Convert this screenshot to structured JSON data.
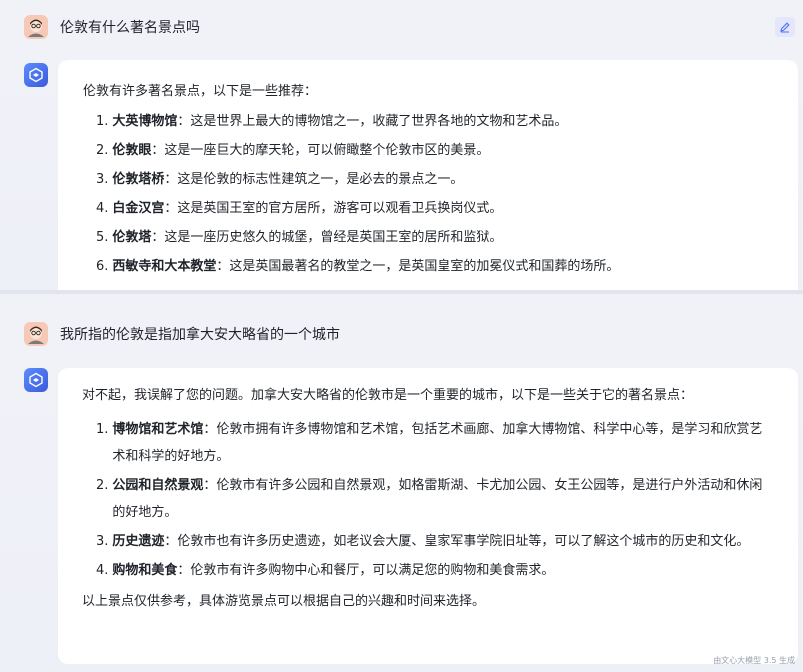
{
  "conversation": [
    {
      "user": {
        "text": "伦敦有什么著名景点吗"
      },
      "bot": {
        "intro": "伦敦有许多著名景点，以下是一些推荐：",
        "items": [
          {
            "num": "1.",
            "title": "大英博物馆",
            "desc": "：这是世界上最大的博物馆之一，收藏了世界各地的文物和艺术品。"
          },
          {
            "num": "2.",
            "title": "伦敦眼",
            "desc": "：这是一座巨大的摩天轮，可以俯瞰整个伦敦市区的美景。"
          },
          {
            "num": "3.",
            "title": "伦敦塔桥",
            "desc": "：这是伦敦的标志性建筑之一，是必去的景点之一。"
          },
          {
            "num": "4.",
            "title": "白金汉宫",
            "desc": "：这是英国王室的官方居所，游客可以观看卫兵换岗仪式。"
          },
          {
            "num": "5.",
            "title": "伦敦塔",
            "desc": "：这是一座历史悠久的城堡，曾经是英国王室的居所和监狱。"
          },
          {
            "num": "6.",
            "title": "西敏寺和大本教堂",
            "desc": "：这是英国最著名的教堂之一，是英国皇室的加冕仪式和国葬的场所。"
          }
        ]
      }
    },
    {
      "user": {
        "text": "我所指的伦敦是指加拿大安大略省的一个城市"
      },
      "bot": {
        "intro": "对不起，我误解了您的问题。加拿大安大略省的伦敦市是一个重要的城市，以下是一些关于它的著名景点：",
        "items": [
          {
            "num": "1.",
            "title": "博物馆和艺术馆",
            "desc": "：伦敦市拥有许多博物馆和艺术馆，包括艺术画廊、加拿大博物馆、科学中心等，是学习和欣赏艺术和科学的好地方。"
          },
          {
            "num": "2.",
            "title": "公园和自然景观",
            "desc": "：伦敦市有许多公园和自然景观，如格雷斯湖、卡尤加公园、女王公园等，是进行户外活动和休闲的好地方。"
          },
          {
            "num": "3.",
            "title": "历史遗迹",
            "desc": "：伦敦市也有许多历史遗迹，如老议会大厦、皇家军事学院旧址等，可以了解这个城市的历史和文化。"
          },
          {
            "num": "4.",
            "title": "购物和美食",
            "desc": "：伦敦市有许多购物中心和餐厅，可以满足您的购物和美食需求。"
          }
        ],
        "outro": "以上景点仅供参考，具体游览景点可以根据自己的兴趣和时间来选择。"
      }
    }
  ],
  "watermark": "由文心大模型 3.5 生成",
  "icons": {
    "user_avatar": "user-avatar-icon",
    "bot_avatar": "ernie-bot-icon",
    "edit": "edit-pencil-icon"
  },
  "colors": {
    "accent": "#4e6ef2",
    "card": "#ffffff",
    "background": "#f0f1f7"
  }
}
